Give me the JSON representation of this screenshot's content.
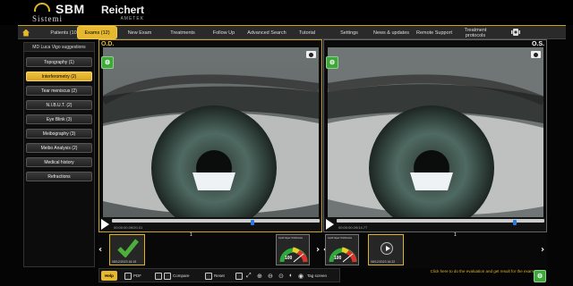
{
  "header": {
    "brand": "SBM",
    "brand_sub": "Sistemi",
    "partner": "Reichert",
    "partner_sub": "AMETEK"
  },
  "nav": {
    "items": [
      {
        "label": "Patients (10)",
        "active": false
      },
      {
        "label": "Exams (12)",
        "active": true
      },
      {
        "label": "New Exam",
        "active": false
      },
      {
        "label": "Treatments",
        "active": false
      },
      {
        "label": "Follow Up",
        "active": false
      },
      {
        "label": "Advanced Search",
        "active": false
      },
      {
        "label": "Tutorial",
        "active": false
      },
      {
        "label": "Settings",
        "active": false
      },
      {
        "label": "News & updates",
        "active": false
      },
      {
        "label": "Remote Support",
        "active": false
      },
      {
        "label": "Treatment protocols",
        "active": false
      }
    ]
  },
  "sidebar": {
    "title": "MD Luca Vigo suggestions",
    "items": [
      {
        "label": "Topography (1)",
        "active": false
      },
      {
        "label": "Interferometry (2)",
        "active": true
      },
      {
        "label": "Tear meniscus (2)",
        "active": false
      },
      {
        "label": "N.I.B.U.T. (2)",
        "active": false
      },
      {
        "label": "Eye Blink (3)",
        "active": false
      },
      {
        "label": "Meibography (3)",
        "active": false
      },
      {
        "label": "Meibo Analysis (2)",
        "active": false
      },
      {
        "label": "Medical history",
        "active": false
      },
      {
        "label": "Refractions",
        "active": false
      }
    ]
  },
  "od": {
    "label": "O.D.",
    "timestamp": "00:00:00.09/20.01",
    "progress": 0.67,
    "strip_count": "1",
    "thumb_caption": "08/12/2023 16:15"
  },
  "os": {
    "label": "O.S.",
    "timestamp": "00:00:00.09/14.77",
    "progress": 0.85,
    "strip_count": "1",
    "thumb_caption": "08/12/2023 16:22"
  },
  "gauges": [
    {
      "title": "Lipid layer thickness",
      "value": "100"
    },
    {
      "title": "Lipid layer thickness",
      "value": "100"
    }
  ],
  "toolbar": {
    "help": "Help",
    "pdf": "PDF",
    "compare": "Compare",
    "reset": "Reset",
    "tag": "Tag screen"
  },
  "hint": "Click here to do the evaluation and get result for the exam",
  "colors": {
    "accent": "#e6b830",
    "panel_border": "#c9a227",
    "ok_green": "#3ea83a"
  }
}
